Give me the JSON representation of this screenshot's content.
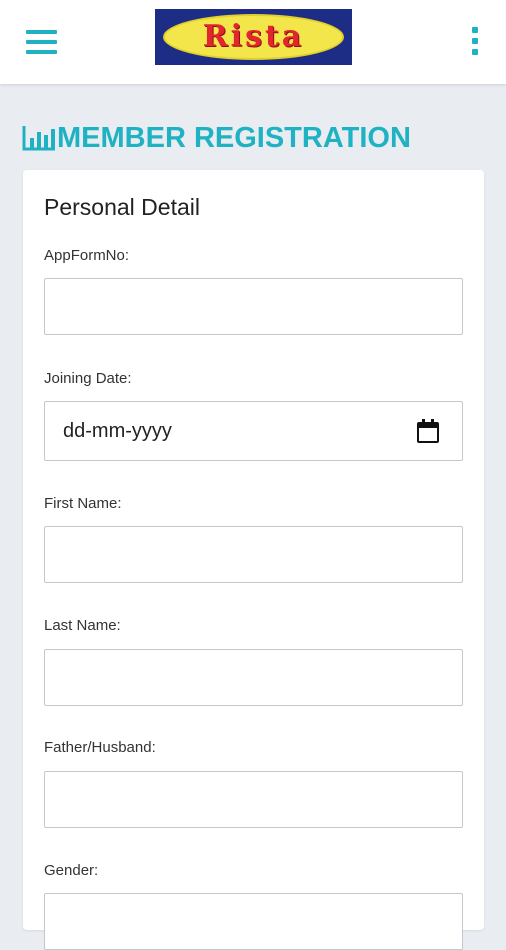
{
  "header": {
    "logo_text": "Rista",
    "menu_icon": "hamburger-menu-icon",
    "overflow_icon": "kebab-menu-icon"
  },
  "page": {
    "title": "MEMBER REGISTRATION",
    "title_icon": "bar-chart-icon"
  },
  "form": {
    "section_title": "Personal Detail",
    "fields": [
      {
        "label": "AppFormNo:",
        "value": "",
        "placeholder": ""
      },
      {
        "label": "Joining Date:",
        "value": "dd-mm-yyyy",
        "placeholder": "dd-mm-yyyy"
      },
      {
        "label": "First Name:",
        "value": "",
        "placeholder": ""
      },
      {
        "label": "Last Name:",
        "value": "",
        "placeholder": ""
      },
      {
        "label": "Father/Husband:",
        "value": "",
        "placeholder": ""
      },
      {
        "label": "Gender:",
        "value": "",
        "placeholder": ""
      }
    ]
  },
  "colors": {
    "accent": "#1fb2c2",
    "background": "#e9ecf1",
    "card": "#ffffff",
    "logo_bg": "#1d2d86",
    "logo_oval": "#f2e64a",
    "logo_text": "#e1262d"
  }
}
